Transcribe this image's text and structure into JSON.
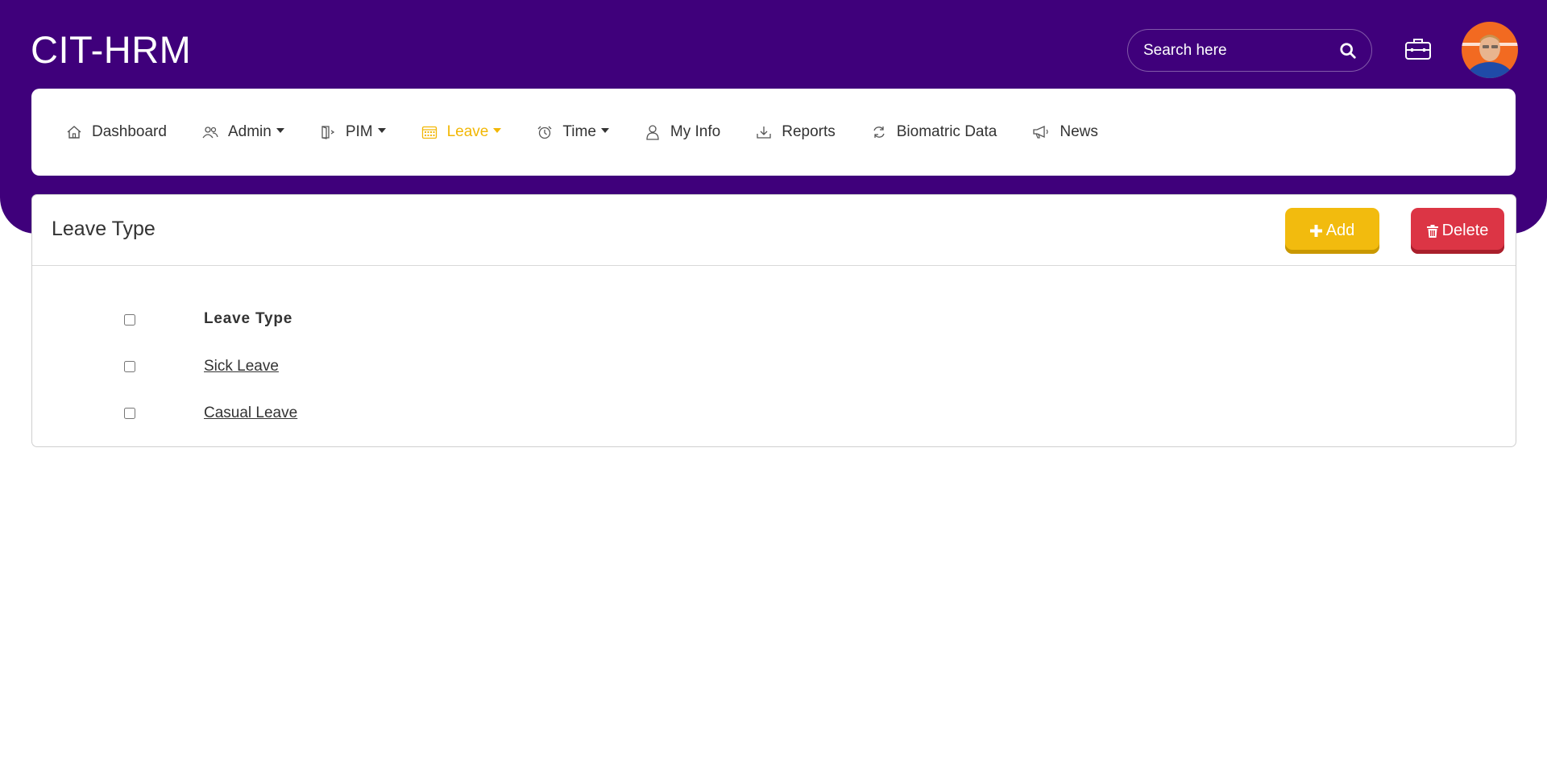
{
  "app": {
    "brand": "CIT-HRM",
    "search_placeholder": "Search here",
    "accent_color": "#3f007b",
    "active_color": "#f2b705"
  },
  "nav": {
    "items": [
      {
        "label": "Dashboard",
        "icon": "home-icon",
        "dropdown": false,
        "active": false
      },
      {
        "label": "Admin",
        "icon": "users-icon",
        "dropdown": true,
        "active": false
      },
      {
        "label": "PIM",
        "icon": "door-icon",
        "dropdown": true,
        "active": false
      },
      {
        "label": "Leave",
        "icon": "calendar-icon",
        "dropdown": true,
        "active": true
      },
      {
        "label": "Time",
        "icon": "alarm-clock-icon",
        "dropdown": true,
        "active": false
      },
      {
        "label": "My Info",
        "icon": "user-icon",
        "dropdown": false,
        "active": false
      },
      {
        "label": "Reports",
        "icon": "download-icon",
        "dropdown": false,
        "active": false
      },
      {
        "label": "Biomatric Data",
        "icon": "refresh-icon",
        "dropdown": false,
        "active": false
      },
      {
        "label": "News",
        "icon": "megaphone-icon",
        "dropdown": false,
        "active": false
      }
    ]
  },
  "card": {
    "title": "Leave Type",
    "add_label": "Add",
    "delete_label": "Delete",
    "add_color": "#f2bb0e",
    "delete_color": "#dc3545"
  },
  "table": {
    "header": "Leave Type",
    "rows": [
      {
        "name": "Sick Leave",
        "checked": false
      },
      {
        "name": "Casual Leave",
        "checked": false
      }
    ]
  }
}
